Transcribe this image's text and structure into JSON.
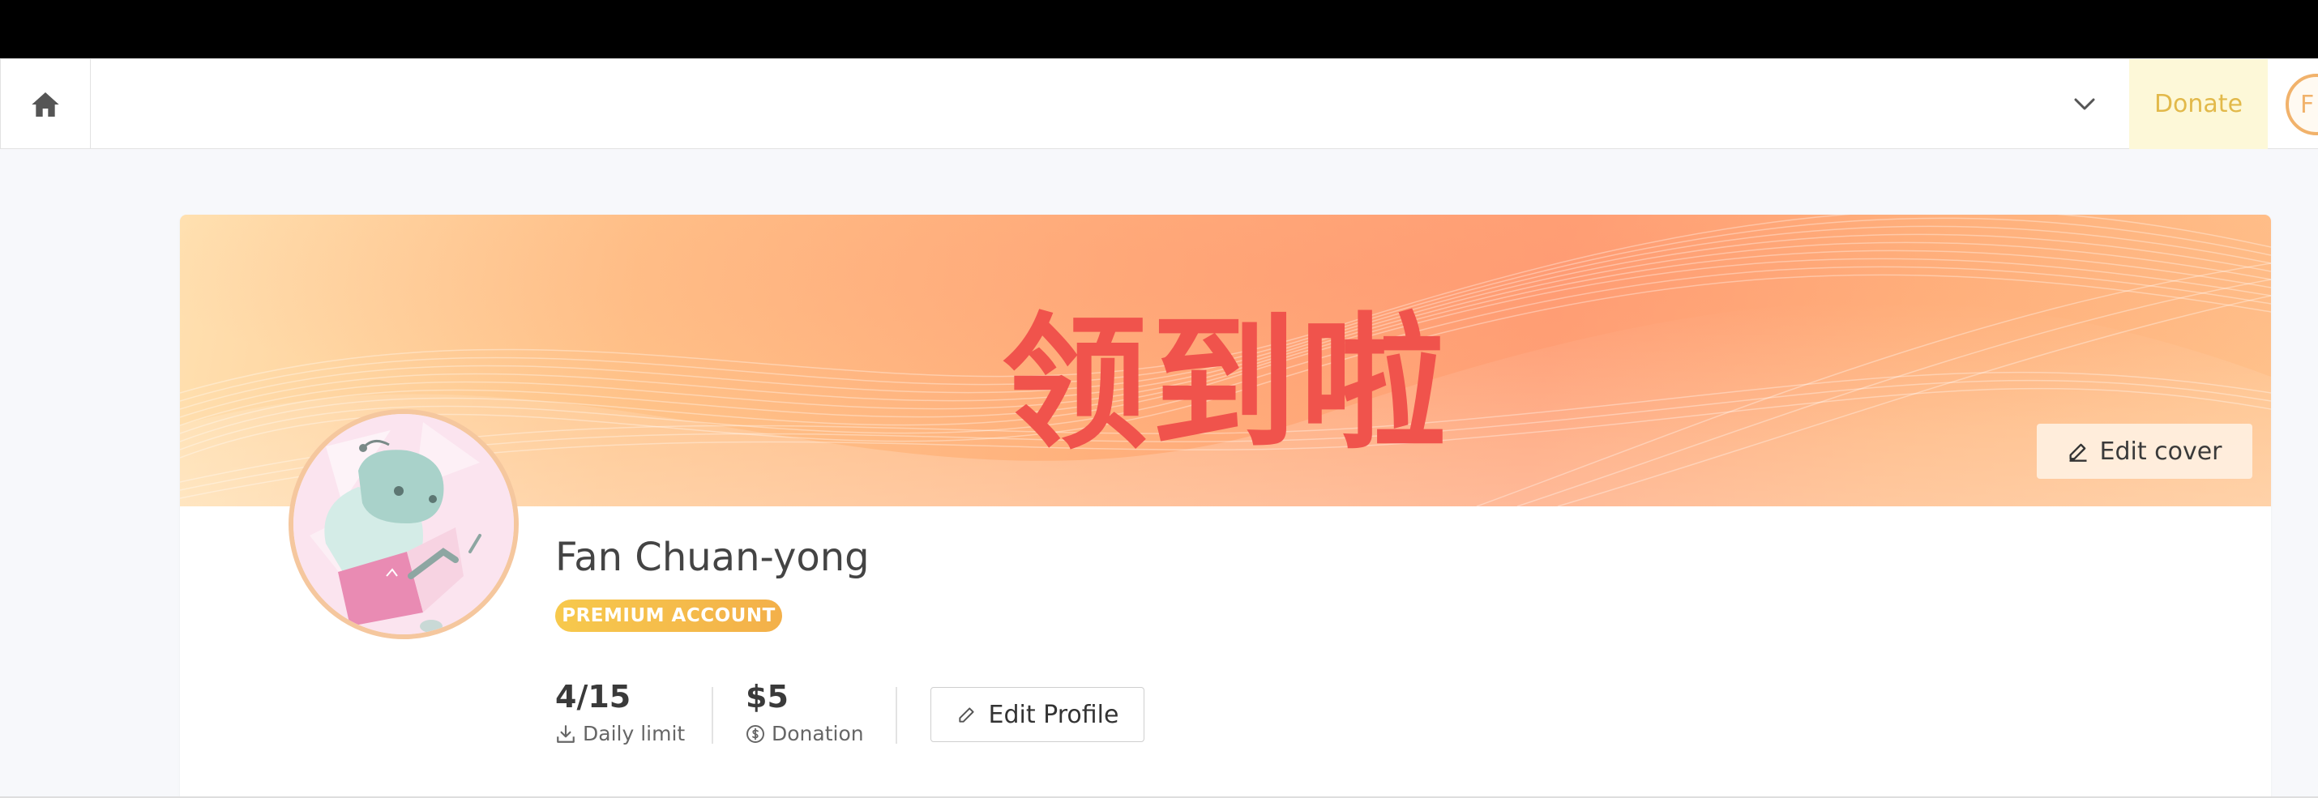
{
  "navbar": {
    "donate_label": "Donate",
    "avatar_initial": "F"
  },
  "cover": {
    "text": "领到啦",
    "edit_cover_label": "Edit cover"
  },
  "profile": {
    "name": "Fan Chuan-yong",
    "badge": "PREMIUM ACCOUNT",
    "stats": [
      {
        "value": "4/15",
        "label": "Daily limit",
        "icon": "download-icon"
      },
      {
        "value": "$5",
        "label": "Donation",
        "icon": "dollar-circle-icon"
      }
    ],
    "edit_profile_label": "Edit Profile"
  },
  "colors": {
    "accent_red": "#f0534c",
    "badge_gold": "#f5c04b",
    "donate_bg": "#fdf8d8",
    "donate_text": "#e2b94a"
  }
}
